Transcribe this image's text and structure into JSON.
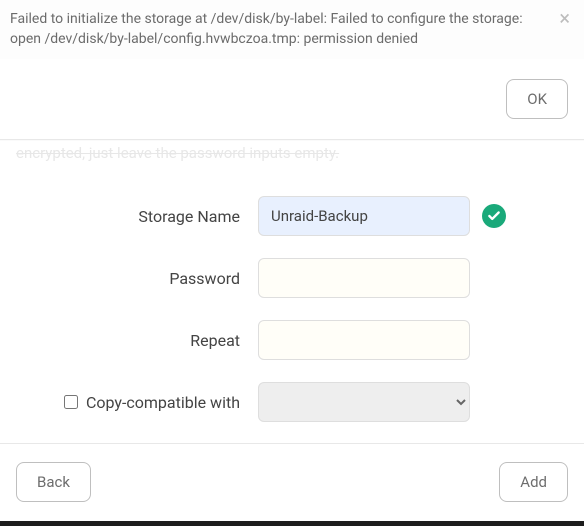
{
  "error": {
    "message": "Failed to initialize the storage at /dev/disk/by-label: Failed to configure the storage: open /dev/disk/by-label/config.hvwbczoa.tmp: permission denied"
  },
  "buttons": {
    "ok": "OK",
    "back": "Back",
    "add": "Add"
  },
  "desc_truncated": "encrypted, just leave the password inputs empty.",
  "form": {
    "storage_name": {
      "label": "Storage Name",
      "value": "Unraid-Backup",
      "valid": true
    },
    "password": {
      "label": "Password",
      "value": ""
    },
    "repeat": {
      "label": "Repeat",
      "value": ""
    },
    "compat": {
      "label": "Copy-compatible with",
      "checked": false,
      "selected": ""
    }
  },
  "colors": {
    "success": "#1aa97a"
  }
}
